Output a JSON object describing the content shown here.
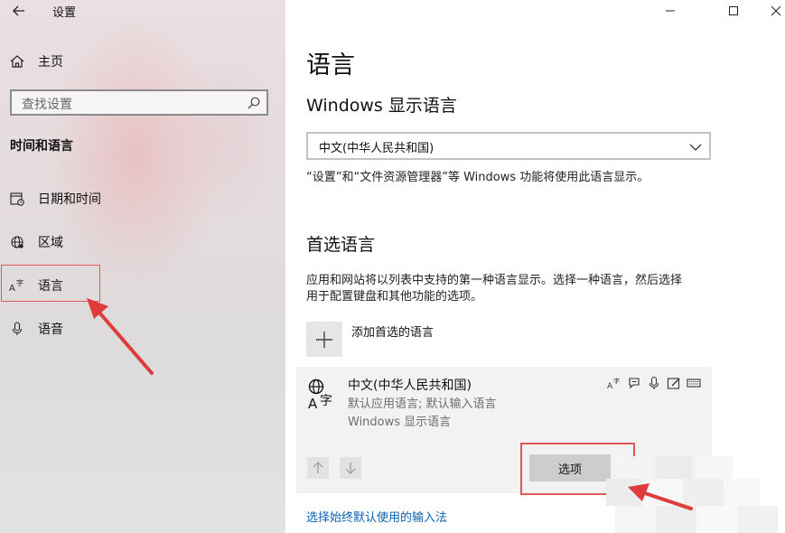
{
  "window": {
    "title": "设置",
    "controls": [
      "minimize-icon",
      "maximize-icon",
      "close-icon"
    ]
  },
  "sidebar": {
    "home": "主页",
    "search_placeholder": "查找设置",
    "section_title": "时间和语言",
    "items": [
      {
        "label": "日期和时间",
        "icon": "calendar-clock-icon"
      },
      {
        "label": "区域",
        "icon": "globe-region-icon"
      },
      {
        "label": "语言",
        "icon": "language-icon",
        "selected": true
      },
      {
        "label": "语音",
        "icon": "microphone-icon"
      }
    ]
  },
  "main": {
    "page_title": "语言",
    "display_language": {
      "heading": "Windows 显示语言",
      "selected": "中文(中华人民共和国)",
      "note": "“设置”和“文件资源管理器”等 Windows 功能将使用此语言显示。"
    },
    "preferred": {
      "heading": "首选语言",
      "description_line1": "应用和网站将以列表中支持的第一种语言显示。选择一种语言，然后选择",
      "description_line2": "用于配置键盘和其他功能的选项。",
      "add_label": "添加首选的语言",
      "language": {
        "name": "中文(中华人民共和国)",
        "sub1": "默认应用语言; 默认输入语言",
        "sub2": "Windows 显示语言",
        "feature_icons": [
          "display-language-icon",
          "speech-icon",
          "microphone-icon",
          "handwriting-icon",
          "keyboard-icon"
        ]
      },
      "options_label": "选项"
    },
    "link": "选择始终默认使用的输入法"
  },
  "colors": {
    "accent_link": "#0a62b3",
    "highlight_red": "#e15656"
  }
}
